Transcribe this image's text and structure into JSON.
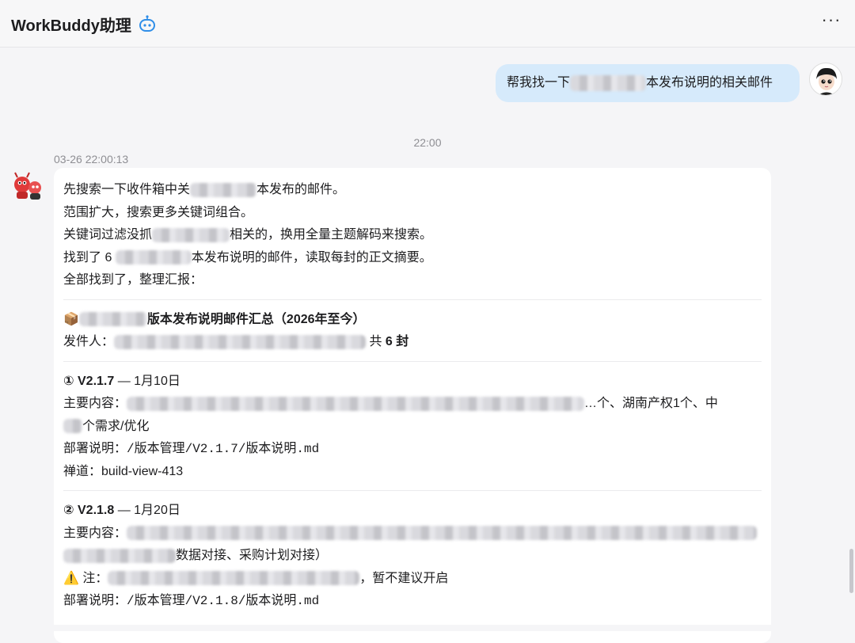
{
  "header": {
    "app_title": "WorkBuddy助理",
    "icon": "robot-icon",
    "more_label": "···"
  },
  "user_message": {
    "before": "帮我找一下",
    "after": "本发布说明的相关邮件",
    "avatar": "user-avatar"
  },
  "time_divider": "22:00",
  "assistant": {
    "timestamp": "03-26 22:00:13",
    "avatar": "assistant-avatar",
    "steps": {
      "s1_a": "先搜索一下收件箱中关",
      "s1_b": "本发布的邮件。",
      "s2": "范围扩大，搜索更多关键词组合。",
      "s3_a": "关键词过滤没抓",
      "s3_b": "相关的，换用全量主题解码来搜索。",
      "s4_a": "找到了 6 ",
      "s4_b": "本发布说明的邮件，读取每封的正文摘要。",
      "s5": "全部找到了，整理汇报："
    },
    "summary": {
      "emoji": "📦",
      "title_after": "版本发布说明邮件汇总（2026年至今）",
      "sender_label": "发件人：",
      "count_prefix": "共 ",
      "count_bold": "6 封"
    },
    "releases": [
      {
        "marker": "①",
        "version": "V2.1.7",
        "date": " — 1月10日",
        "content_label": "主要内容：",
        "content_tail": "…个、湖南产权1个、中",
        "content_line2": "个需求/优化",
        "deploy": "部署说明：/版本管理/V2.1.7/版本说明.md",
        "lane": "禅道：build-view-413"
      },
      {
        "marker": "②",
        "version": "V2.1.8",
        "date": " — 1月20日",
        "content_label": "主要内容：",
        "content_line2_tail": "数据对接、采购计划对接）",
        "warning_icon": "⚠️",
        "note_label": "注：",
        "note_tail": "，暂不建议开启",
        "deploy": "部署说明：/版本管理/V2.1.8/版本说明.md"
      }
    ]
  }
}
